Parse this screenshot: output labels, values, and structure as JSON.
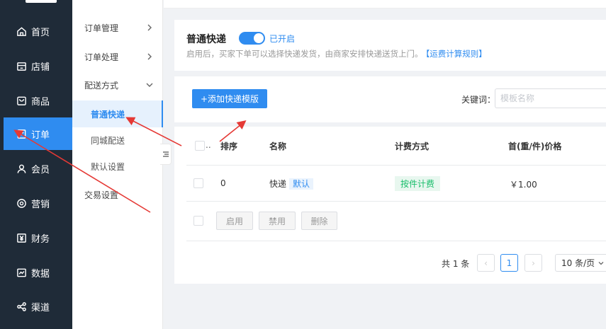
{
  "nav": {
    "items": [
      {
        "label": "首页",
        "icon": "home-icon"
      },
      {
        "label": "店铺",
        "icon": "store-icon"
      },
      {
        "label": "商品",
        "icon": "goods-icon"
      },
      {
        "label": "订单",
        "icon": "order-icon",
        "active": true
      },
      {
        "label": "会员",
        "icon": "user-icon"
      },
      {
        "label": "营销",
        "icon": "marketing-icon"
      },
      {
        "label": "财务",
        "icon": "yen-icon"
      },
      {
        "label": "数据",
        "icon": "chart-icon"
      },
      {
        "label": "渠道",
        "icon": "share-icon"
      }
    ]
  },
  "submenu": {
    "order_manage": "订单管理",
    "order_process": "订单处理",
    "delivery": "配送方式",
    "express": "普通快递",
    "local": "同城配送",
    "default_setting": "默认设置",
    "trade_setting": "交易设置"
  },
  "header": {
    "title": "普通快递",
    "switch_label": "已开启",
    "switch_on": true,
    "desc": "启用后，买家下单可以选择快递发货，由商家安排快递送货上门。",
    "rule_link": "【运费计算规则】"
  },
  "toolbar": {
    "add_label": "+添加快递模版",
    "keyword_label": "关键词：",
    "keyword_placeholder": "模板名称"
  },
  "table": {
    "headers": {
      "sort": "排序",
      "name": "名称",
      "billing": "计费方式",
      "price": "首(重/件)价格"
    },
    "rows": [
      {
        "sort": "0",
        "name": "快递",
        "tag": "默认",
        "billing": "按件计费",
        "price": "￥1.00"
      }
    ],
    "actions": {
      "enable": "启用",
      "disable": "禁用",
      "delete": "删除"
    }
  },
  "pagination": {
    "total": "共 1 条",
    "current": "1",
    "prev": "‹",
    "next": "›",
    "page_size": "10 条/页"
  },
  "colors": {
    "accent": "#2f8cf0",
    "nav_bg": "#1f2b38",
    "annotation": "#e53935"
  }
}
